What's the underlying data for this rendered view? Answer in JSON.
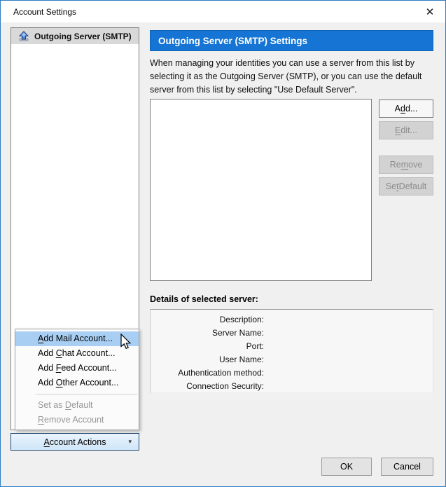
{
  "window": {
    "title": "Account Settings",
    "close_icon": "✕"
  },
  "sidebar": {
    "selected_item": {
      "label": "Outgoing Server (SMTP)",
      "icon": "outgoing-server-arrow-up"
    },
    "account_actions": {
      "label": "Account Actions",
      "accel": 0,
      "dropdown_icon": "▾"
    }
  },
  "menu": {
    "items": [
      {
        "label": "Add Mail Account...",
        "accel": 0,
        "state": "highlighted"
      },
      {
        "label": "Add Chat Account...",
        "accel": 4,
        "state": "normal"
      },
      {
        "label": "Add Feed Account...",
        "accel": 4,
        "state": "normal"
      },
      {
        "label": "Add Other Account...",
        "accel": 4,
        "state": "normal"
      },
      {
        "label": "Set as Default",
        "accel": 7,
        "state": "disabled"
      },
      {
        "label": "Remove Account",
        "accel": 0,
        "state": "disabled"
      }
    ]
  },
  "main": {
    "header": "Outgoing Server (SMTP) Settings",
    "description": "When managing your identities you can use a server from this list by selecting it as the Outgoing Server (SMTP), or you can use the default server from this list by selecting \"Use Default Server\".",
    "server_list": {
      "items": []
    },
    "side_buttons": {
      "add": {
        "label": "Add...",
        "accel": 1,
        "enabled": true
      },
      "edit": {
        "label": "Edit...",
        "accel": 0,
        "enabled": false
      },
      "remove": {
        "label": "Remove",
        "accel": 2,
        "enabled": false
      },
      "set_default": {
        "label": "Set Default",
        "accel": 2,
        "enabled": false
      }
    },
    "details": {
      "title": "Details of selected server:",
      "fields": [
        "Description:",
        "Server Name:",
        "Port:",
        "User Name:",
        "Authentication method:",
        "Connection Security:"
      ]
    }
  },
  "footer": {
    "ok": {
      "label": "OK"
    },
    "cancel": {
      "label": "Cancel"
    }
  },
  "colors": {
    "window_border": "#2c7bc2",
    "panel_header_bg": "#1574d4",
    "menu_highlight": "#a8cff3",
    "account_actions_border": "#26496d",
    "account_actions_bg": "#d9eafa",
    "selected_tree_item_bg": "#d9d9d9"
  }
}
